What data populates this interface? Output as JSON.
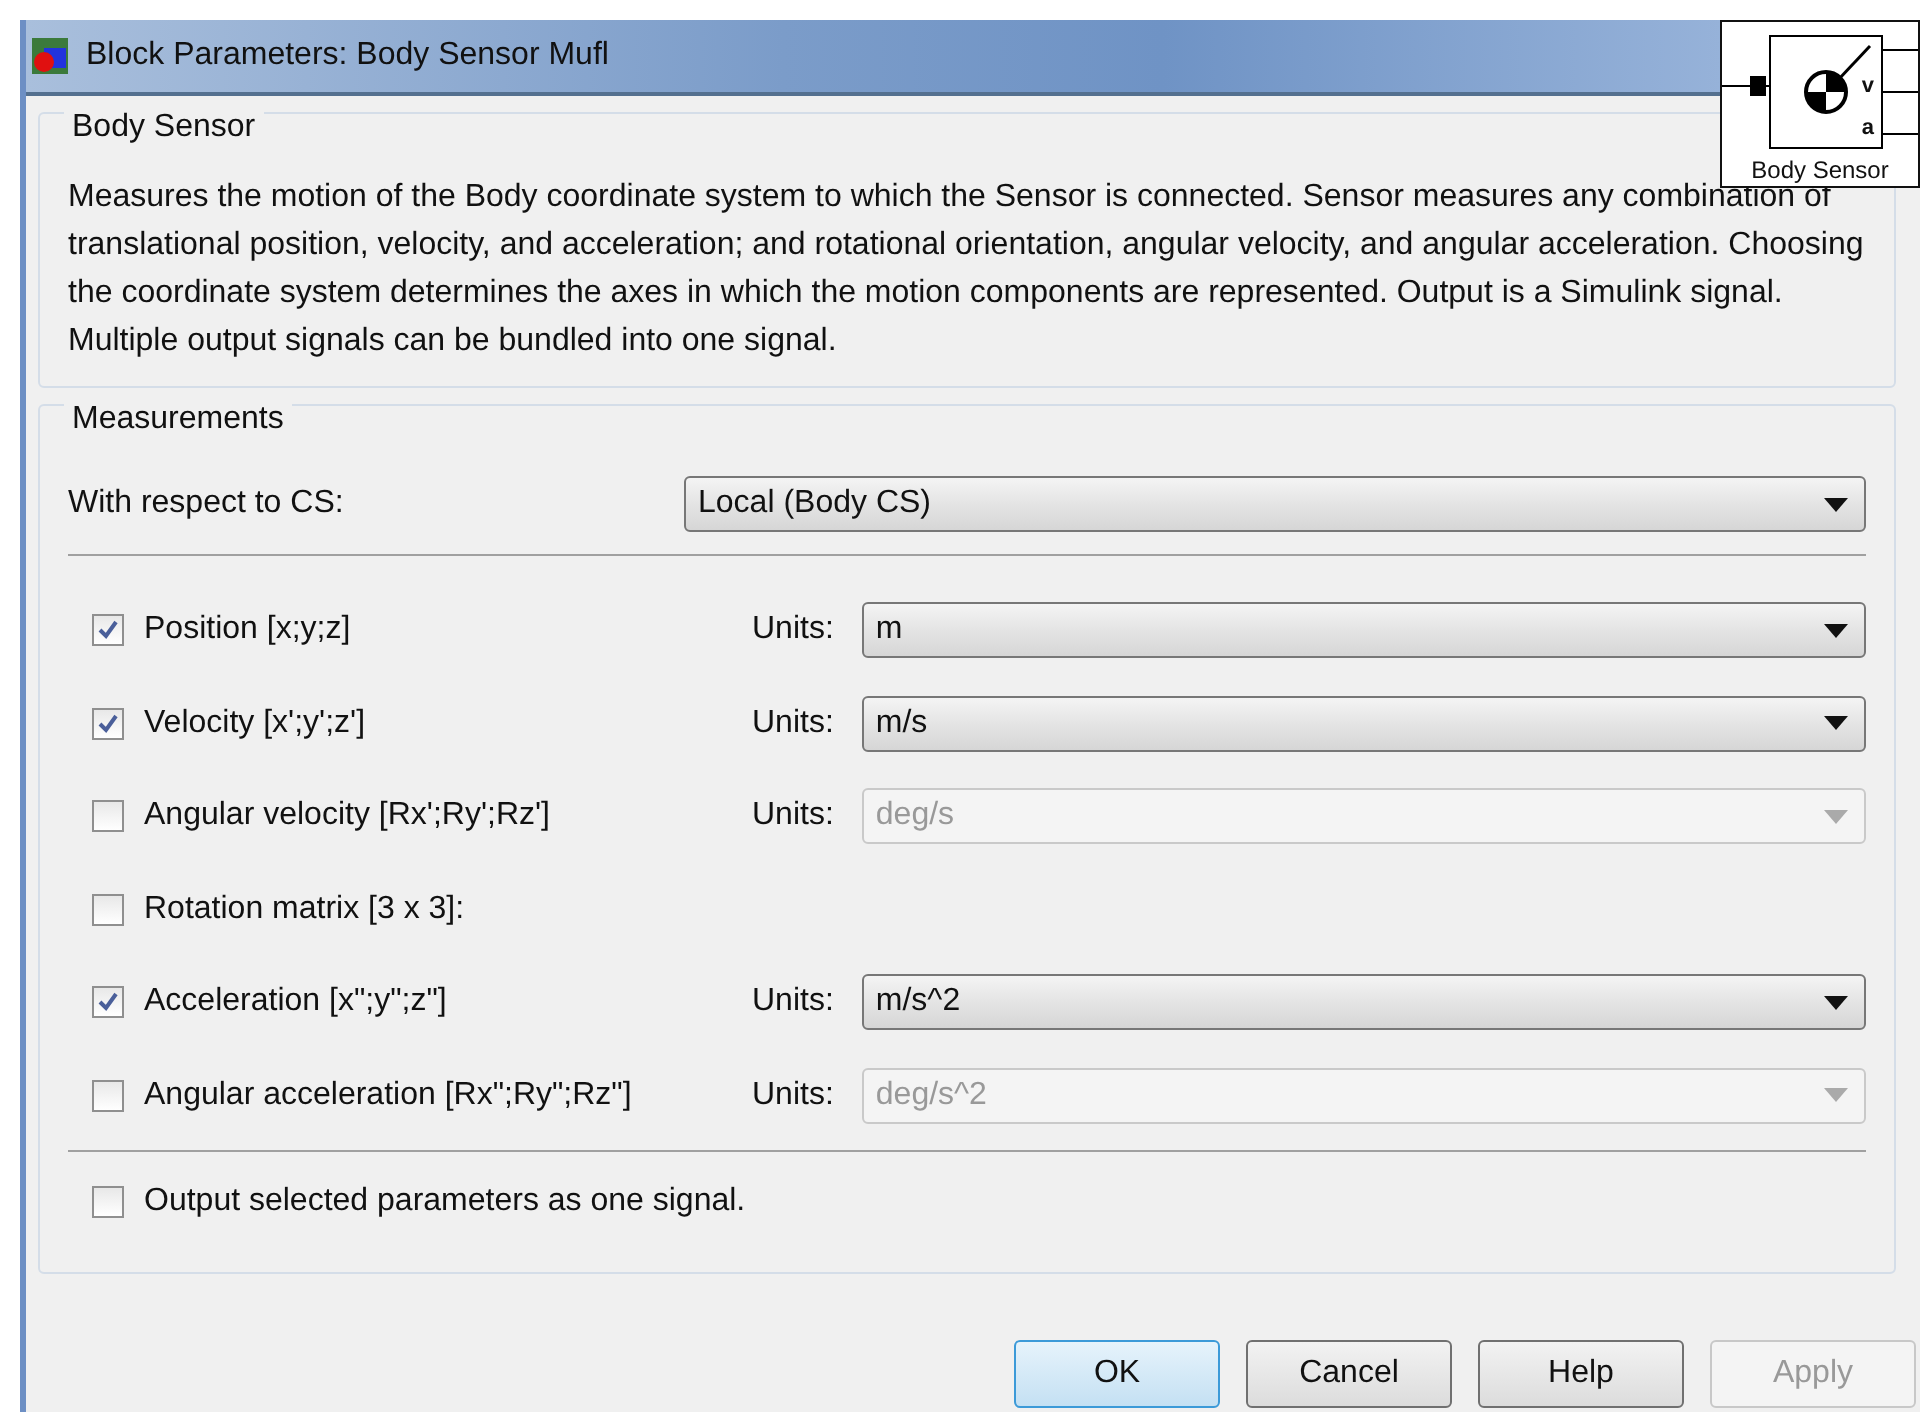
{
  "window": {
    "title": "Block Parameters: Body Sensor Mufl"
  },
  "block_preview": {
    "label": "Body Sensor",
    "ports": [
      "v",
      "a"
    ]
  },
  "description_group": {
    "title": "Body Sensor",
    "text": "Measures the motion of the Body coordinate system to which the Sensor is connected. Sensor measures any combination of translational position, velocity, and acceleration; and rotational orientation, angular velocity, and angular acceleration. Choosing the coordinate system determines the axes in which the motion components are represented. Output is a Simulink signal. Multiple output signals can be bundled into one signal."
  },
  "measurements": {
    "title": "Measurements",
    "reference": {
      "label": "With respect to CS:",
      "value": "Local (Body CS)"
    },
    "rows": [
      {
        "label": "Position [x;y;z]",
        "checked": true,
        "units": {
          "label": "Units:",
          "value": "m",
          "disabled": false
        }
      },
      {
        "label": "Velocity [x';y';z']",
        "checked": true,
        "units": {
          "label": "Units:",
          "value": "m/s",
          "disabled": false
        }
      },
      {
        "label": "Angular velocity [Rx';Ry';Rz']",
        "checked": false,
        "units": {
          "label": "Units:",
          "value": "deg/s",
          "disabled": true
        }
      },
      {
        "label": "Rotation matrix [3 x 3]:",
        "checked": false
      },
      {
        "label": "Acceleration [x\";y\";z\"]",
        "checked": true,
        "units": {
          "label": "Units:",
          "value": "m/s^2",
          "disabled": false
        }
      },
      {
        "label": "Angular acceleration [Rx\";Ry\";Rz\"]",
        "checked": false,
        "units": {
          "label": "Units:",
          "value": "deg/s^2",
          "disabled": true
        }
      }
    ],
    "output_option": {
      "label": "Output selected parameters as one signal.",
      "checked": false
    }
  },
  "buttons": [
    {
      "label": "OK",
      "default": true,
      "disabled": false
    },
    {
      "label": "Cancel",
      "default": false,
      "disabled": false
    },
    {
      "label": "Help",
      "default": false,
      "disabled": false
    },
    {
      "label": "Apply",
      "default": false,
      "disabled": true
    }
  ]
}
